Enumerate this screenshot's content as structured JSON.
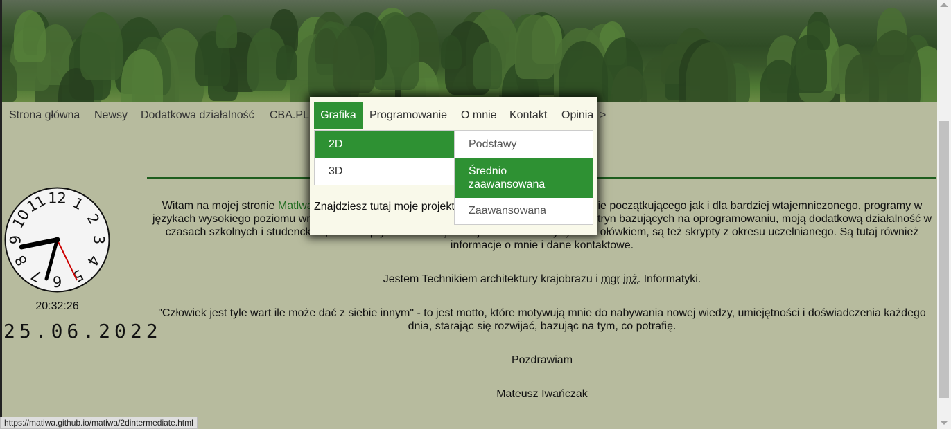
{
  "nav": {
    "items": [
      "Strona główna",
      "Newsy",
      "Dodatkowa działalność",
      "CBA.PL"
    ]
  },
  "popup": {
    "nav": [
      "Grafika",
      "Programowanie",
      "O mnie",
      "Kontakt",
      "Opinia"
    ],
    "nav_arrow": ">",
    "submenu": [
      "2D",
      "3D"
    ],
    "submenu2": [
      "Podstawy",
      "Średnio zaawansowana",
      "Zaawansowana"
    ],
    "text_lines": [
      "Znajdziesz tutaj moje projekt",
      "poziomu wraz z dokumenta",
      "w czasach szkolnych i studenckich, a także prywatne takie jak majsterkowanie"
    ]
  },
  "clock": {
    "time": "20:32:26",
    "date": "25.06.2022",
    "numerals": [
      "12",
      "1",
      "2",
      "3",
      "4",
      "5",
      "6",
      "7",
      "8",
      "9",
      "10",
      "11"
    ]
  },
  "content": {
    "p1_prefix": "Witam na mojej stronie ",
    "p1_link": "Matlwa",
    "p1_rest": " Znajdziesz tutaj moje projekty z grafiki 2D i 3D na poziomie początkującego jak i dla bardziej wtajemniczonego, programy w językach wysokiego poziomu wraz z dokumentacją, przykłady funkcjonalności i wyglądu witryn bazujących na oprogramowaniu, moją dodatkową działalność w czasach szkolnych i studenckich, a także prywatne takie jak majsterkowanie czy rysunki ołówkiem, są też skrypty z okresu uczelnianego. Są tutaj również informacje o mnie i dane kontaktowe.",
    "p2_prefix": "Jestem Technikiem architektury krajobrazu i ",
    "p2_abbr1": "mgr",
    "p2_abbr2": "inż.",
    "p2_suffix": " Informatyki.",
    "p3": "\"Człowiek jest tyle wart ile może dać z siebie innym\" - to jest motto, które motywują mnie do nabywania nowej wiedzy, umiejętności i doświadczenia każdego dnia, starając się rozwijać, bazując na tym, co potrafię.",
    "p4": "Pozdrawiam",
    "p5": "Mateusz Iwańczak"
  },
  "status_url": "https://matiwa.github.io/matiwa/2dintermediate.html",
  "colors": {
    "accent": "#2e9133",
    "page_bg": "#b7bb9e",
    "popup_bg": "#f9f9ea",
    "rule": "#1e5e1e"
  }
}
